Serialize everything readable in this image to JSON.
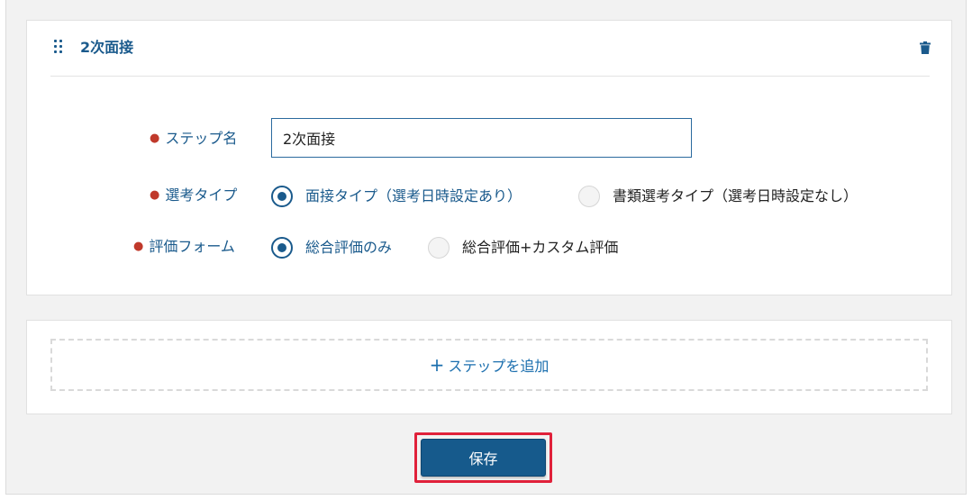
{
  "step": {
    "title": "2次面接",
    "delete_icon": "trash-icon",
    "drag_icon": "drag-handle-icon"
  },
  "fields": {
    "step_name": {
      "label": "ステップ名",
      "value": "2次面接"
    },
    "selection_type": {
      "label": "選考タイプ",
      "options": [
        {
          "label": "面接タイプ（選考日時設定あり）",
          "selected": true
        },
        {
          "label": "書類選考タイプ（選考日時設定なし）",
          "selected": false
        }
      ]
    },
    "evaluation_form": {
      "label": "評価フォーム",
      "options": [
        {
          "label": "総合評価のみ",
          "selected": true
        },
        {
          "label": "総合評価+カスタム評価",
          "selected": false
        }
      ]
    }
  },
  "add_step": {
    "icon": "+",
    "label": "ステップを追加"
  },
  "save": {
    "label": "保存"
  },
  "colors": {
    "accent": "#1a5a8c",
    "required": "#c0392b",
    "highlight": "#e0213a"
  }
}
